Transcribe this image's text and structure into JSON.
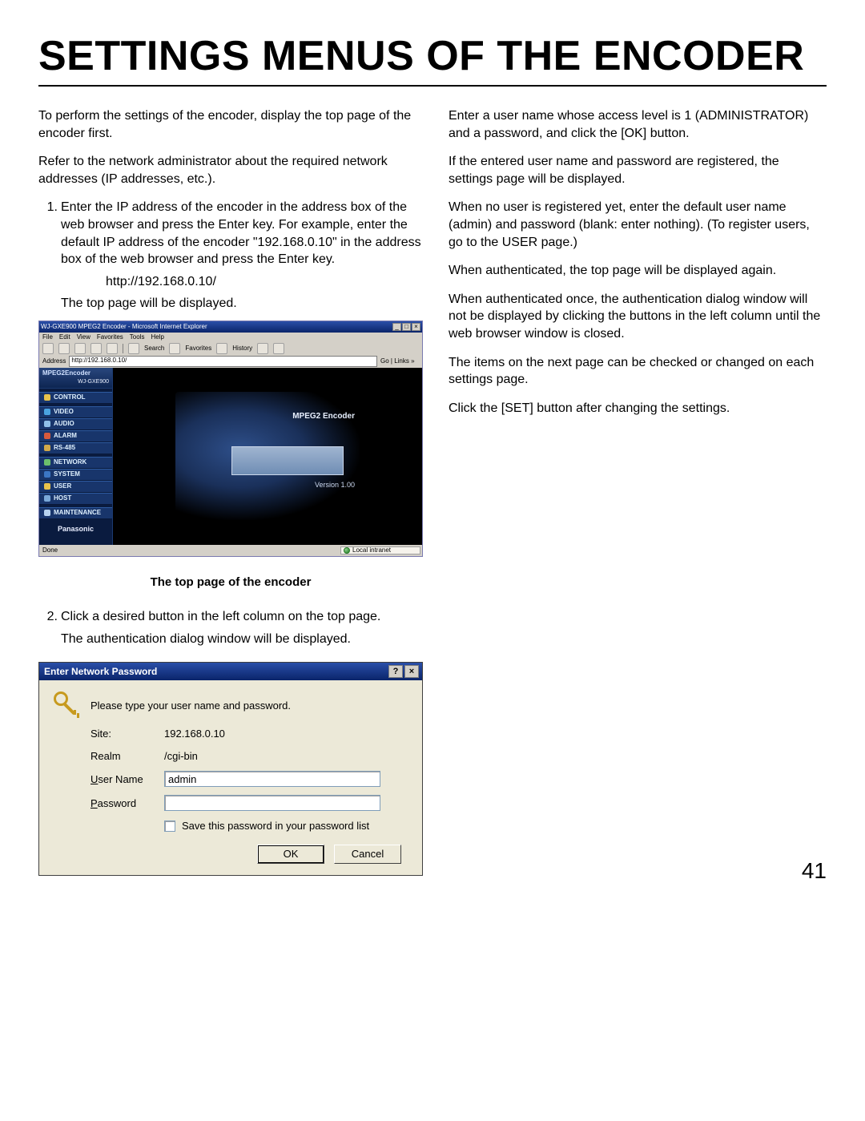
{
  "page_title": "SETTINGS MENUS OF THE ENCODER",
  "left": {
    "intro1": "To perform the settings of the encoder, display the top page of the encoder first.",
    "intro2": "Refer to the network administrator about the required network addresses (IP addresses, etc.).",
    "step1": {
      "num": "1.",
      "t1": "Enter the IP address of the encoder in the address box of the web browser and press the Enter key. For example, enter the default IP address of the encoder \"192.168.0.10\" in the address box of the web browser and press the Enter key.",
      "url": "http://192.168.0.10/",
      "t2": "The top page will be displayed."
    },
    "caption": "The top page of the encoder",
    "step2": {
      "num": "2.",
      "t1": "Click a desired button in the left column on the top page.",
      "t2": "The authentication dialog window will be displayed."
    }
  },
  "right": {
    "p1": "Enter a user name whose access level is 1 (ADMINISTRATOR) and a password, and click the [OK] button.",
    "p2": "If the entered user name and password are registered, the settings page will be displayed.",
    "p3": "When no user is registered yet, enter the default user name (admin) and password (blank: enter nothing). (To register users, go to the USER page.)",
    "p4": "When authenticated, the top page will be displayed again.",
    "p5": "When authenticated once, the authentication dialog window will not be displayed by clicking the buttons in the left column until the web browser window is closed.",
    "p6": "The items on the next page can be checked or changed on each settings page.",
    "p7": "Click the [SET] button after changing the settings."
  },
  "ie": {
    "title": "WJ-GXE900 MPEG2 Encoder - Microsoft Internet Explorer",
    "menu": [
      "File",
      "Edit",
      "View",
      "Favorites",
      "Tools",
      "Help"
    ],
    "toolbar_labels": [
      "Search",
      "Favorites",
      "History"
    ],
    "address_label": "Address",
    "address_value": "http://192.168.0.10/",
    "go_label": "Go",
    "links_label": "Links »",
    "side_header_line1": "MPEG2Encoder",
    "side_header_line2": "WJ-GXE900",
    "side_items": [
      "CONTROL",
      "VIDEO",
      "AUDIO",
      "ALARM",
      "RS-485",
      "NETWORK",
      "SYSTEM",
      "USER",
      "HOST",
      "MAINTENANCE"
    ],
    "brand": "Panasonic",
    "splash_title": "MPEG2 Encoder",
    "splash_version": "Version 1.00",
    "status_left": "Done",
    "status_zone": "Local intranet"
  },
  "dlg": {
    "title": "Enter Network Password",
    "prompt": "Please type your user name and password.",
    "site_label": "Site:",
    "site_value": "192.168.0.10",
    "realm_label": "Realm",
    "realm_value": "/cgi-bin",
    "user_label_pre": "U",
    "user_label_rest": "ser Name",
    "user_value": "admin",
    "pass_label_pre": "P",
    "pass_label_rest": "assword",
    "pass_value": "",
    "save_pre": "S",
    "save_rest": "ave this password in your password list",
    "ok": "OK",
    "cancel": "Cancel"
  },
  "page_number": "41"
}
